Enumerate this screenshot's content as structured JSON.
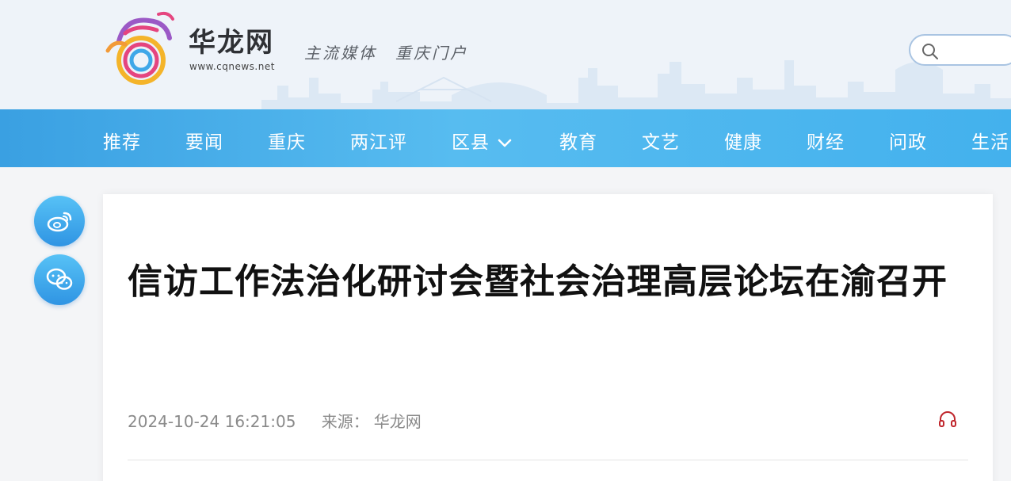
{
  "header": {
    "brand_name": "华龙网",
    "brand_url": "www.cqnews.net",
    "slogan": "主流媒体　重庆门户",
    "search_icon": "search-icon"
  },
  "nav": {
    "items": [
      "推荐",
      "要闻",
      "重庆",
      "两江评",
      "区县",
      "教育",
      "文艺",
      "健康",
      "财经",
      "问政",
      "生活"
    ],
    "dropdown_icon": "chevron-down-icon"
  },
  "share": {
    "icons": [
      "weibo-icon",
      "wechat-icon"
    ]
  },
  "article": {
    "title": "信访工作法治化研讨会暨社会治理高层论坛在渝召开",
    "datetime": "2024-10-24 16:21:05",
    "source_label": "来源：",
    "source": "华龙网",
    "audio_icon": "headphones-icon"
  },
  "colors": {
    "nav_bg": "#4bb3ec",
    "title_text": "#111111",
    "meta_text": "#8a8a8a",
    "audio_icon": "#c0272d"
  }
}
